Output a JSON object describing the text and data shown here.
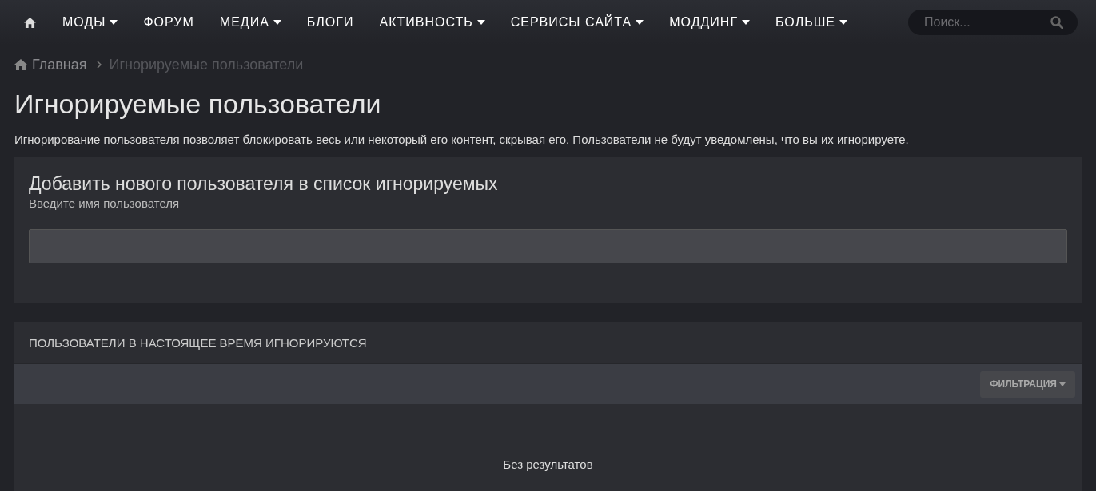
{
  "nav": {
    "items": [
      {
        "label": "МОДЫ",
        "has_dropdown": true
      },
      {
        "label": "ФОРУМ",
        "has_dropdown": false
      },
      {
        "label": "МЕДИА",
        "has_dropdown": true
      },
      {
        "label": "БЛОГИ",
        "has_dropdown": false
      },
      {
        "label": "АКТИВНОСТЬ",
        "has_dropdown": true
      },
      {
        "label": "СЕРВИСЫ САЙТА",
        "has_dropdown": true
      },
      {
        "label": "МОДДИНГ",
        "has_dropdown": true
      },
      {
        "label": "БОЛЬШЕ",
        "has_dropdown": true
      }
    ],
    "search": {
      "placeholder": "Поиск..."
    }
  },
  "breadcrumb": [
    "Главная",
    "Игнорируемые пользователи"
  ],
  "page": {
    "title": "Игнорируемые пользователи",
    "description": "Игнорирование пользователя позволяет блокировать весь или некоторый его контент, скрывая его. Пользователи не будут уведомлены, что вы их игнорируете."
  },
  "add_user": {
    "title": "Добавить нового пользователя в список игнорируемых",
    "label": "Введите имя пользователя"
  },
  "ignored_list": {
    "title": "ПОЛЬЗОВАТЕЛИ В НАСТОЯЩЕЕ ВРЕМЯ ИГНОРИРУЮТСЯ",
    "filter_button": "ФИЛЬТРАЦИЯ",
    "empty_text": "Без результатов"
  }
}
